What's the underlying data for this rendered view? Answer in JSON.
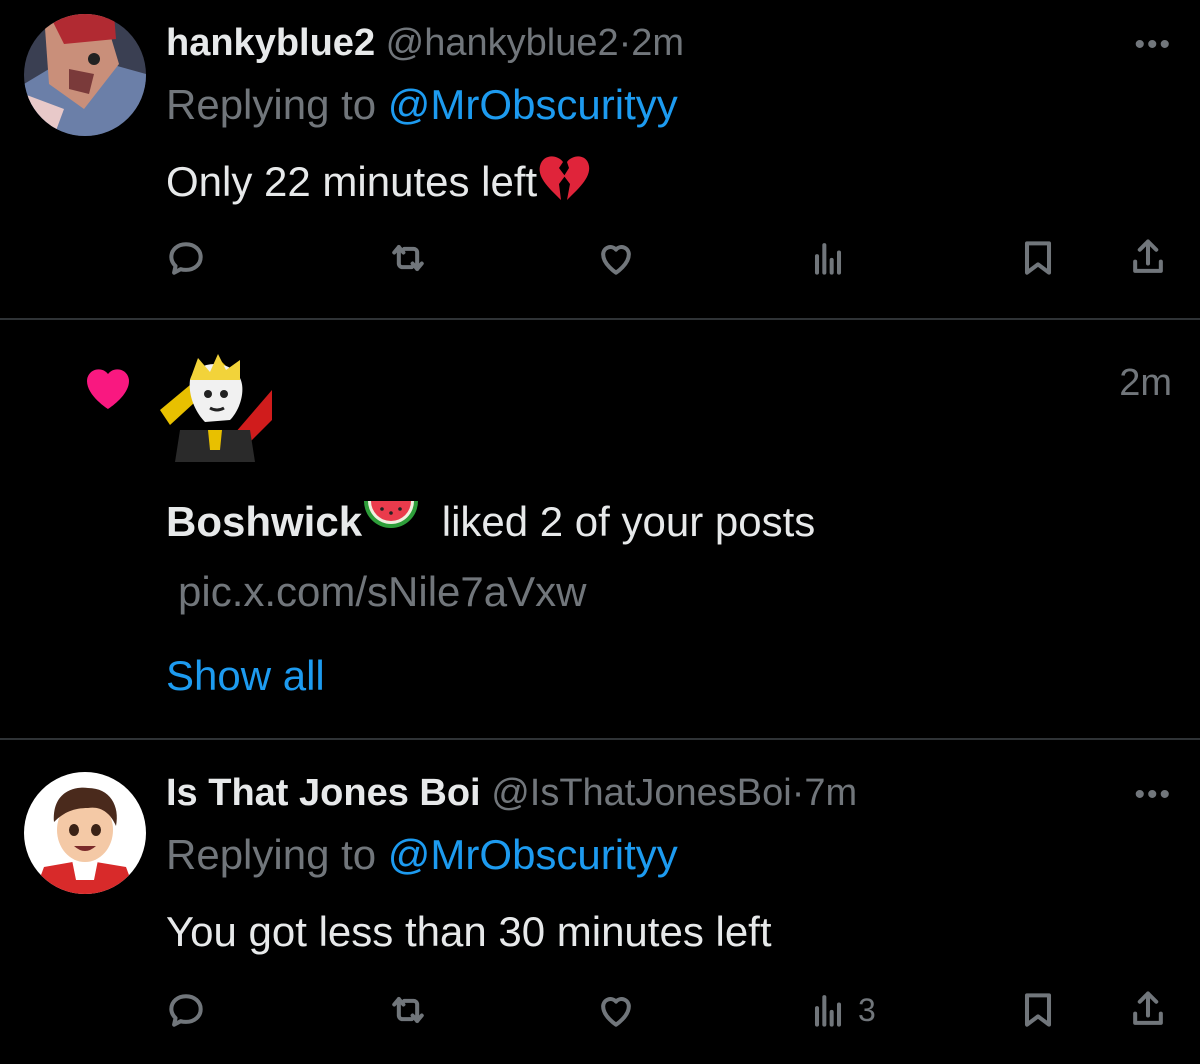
{
  "post1": {
    "display_name": "hankyblue2",
    "handle": "@hankyblue2",
    "separator": "·",
    "time": "2m",
    "replying_prefix": "Replying to",
    "replying_mention": "@MrObscurityy",
    "text": "Only 22 minutes left",
    "text_emoji": "broken-heart-icon",
    "views_count": ""
  },
  "notification": {
    "icon": "heart-icon",
    "time": "2m",
    "actor": "Boshwick",
    "actor_emoji": "watermelon-icon",
    "action_text": "liked 2 of your posts",
    "link": "pic.x.com/sNile7aVxw",
    "show_all": "Show all"
  },
  "post2": {
    "display_name": "Is That Jones Boi",
    "handle": "@IsThatJonesBoi",
    "separator": "·",
    "time": "7m",
    "replying_prefix": "Replying to",
    "replying_mention": "@MrObscurityy",
    "text": "You got less than 30 minutes left",
    "views_count": "3"
  },
  "colors": {
    "background": "#000000",
    "text_primary": "#e7e9ea",
    "text_secondary": "#71767b",
    "accent_blue": "#1d9bf0",
    "like_pink": "#f91880",
    "divider": "#2f3336"
  }
}
